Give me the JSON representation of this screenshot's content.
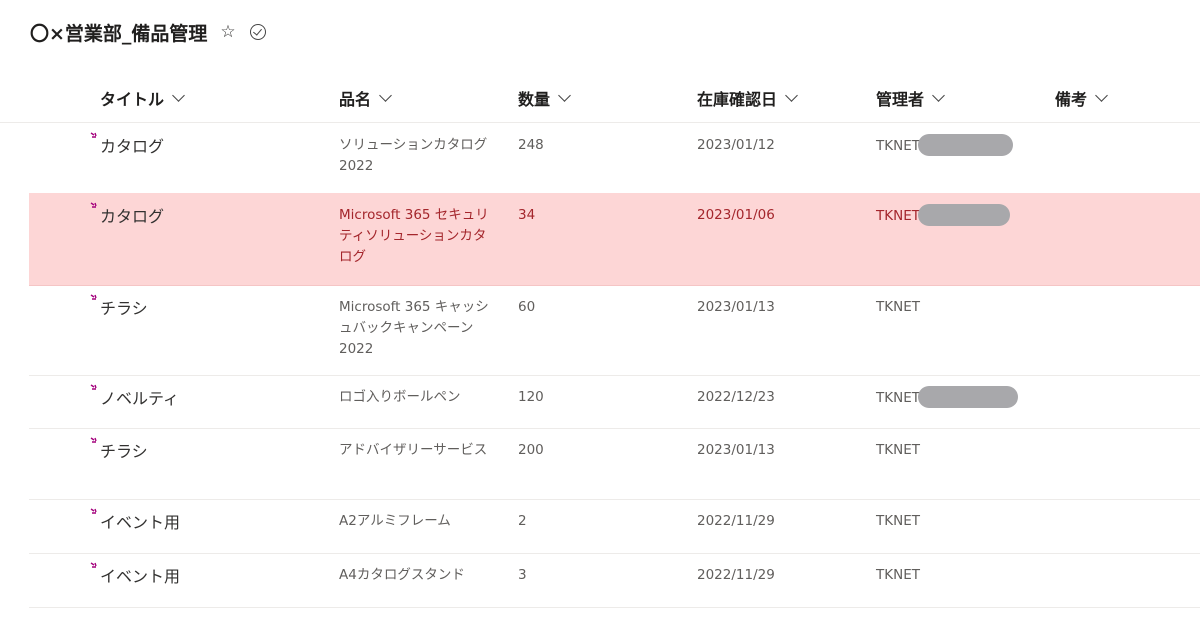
{
  "list": {
    "title": "〇×営業部_備品管理",
    "favorite_icon": "star-icon",
    "status_icon": "check-circle-icon"
  },
  "columns": {
    "title": "タイトル",
    "name": "品名",
    "quantity": "数量",
    "stock_date": "在庫確認日",
    "manager": "管理者",
    "notes": "備考"
  },
  "rows": [
    {
      "title": "カタログ",
      "name": "ソリューションカタログ2022",
      "quantity": "248",
      "stock_date": "2023/01/12",
      "manager": "TKNET",
      "manager_redacted": true,
      "notes": "",
      "highlighted": false
    },
    {
      "title": "カタログ",
      "name": "Microsoft 365 セキュリティソリューションカタログ",
      "quantity": "34",
      "stock_date": "2023/01/06",
      "manager": "TKNET",
      "manager_redacted": true,
      "notes": "",
      "highlighted": true
    },
    {
      "title": "チラシ",
      "name": "Microsoft 365 キャッシュバックキャンペーン2022",
      "quantity": "60",
      "stock_date": "2023/01/13",
      "manager": "TKNET",
      "manager_redacted": false,
      "notes": "",
      "highlighted": false
    },
    {
      "title": "ノベルティ",
      "name": "ロゴ入りボールペン",
      "quantity": "120",
      "stock_date": "2022/12/23",
      "manager": "TKNET",
      "manager_redacted": true,
      "notes": "",
      "highlighted": false
    },
    {
      "title": "チラシ",
      "name": "アドバイザリーサービス",
      "quantity": "200",
      "stock_date": "2023/01/13",
      "manager": "TKNET",
      "manager_redacted": false,
      "notes": "",
      "highlighted": false
    },
    {
      "title": "イベント用",
      "name": "A2アルミフレーム",
      "quantity": "2",
      "stock_date": "2022/11/29",
      "manager": "TKNET",
      "manager_redacted": false,
      "notes": "",
      "highlighted": false
    },
    {
      "title": "イベント用",
      "name": "A4カタログスタンド",
      "quantity": "3",
      "stock_date": "2022/11/29",
      "manager": "TKNET",
      "manager_redacted": false,
      "notes": "",
      "highlighted": false
    }
  ],
  "colors": {
    "highlight_bg": "#fdd6d6",
    "highlight_text": "#a4262c",
    "new_indicator": "#a4007c",
    "redaction": "#a8a8ab"
  }
}
